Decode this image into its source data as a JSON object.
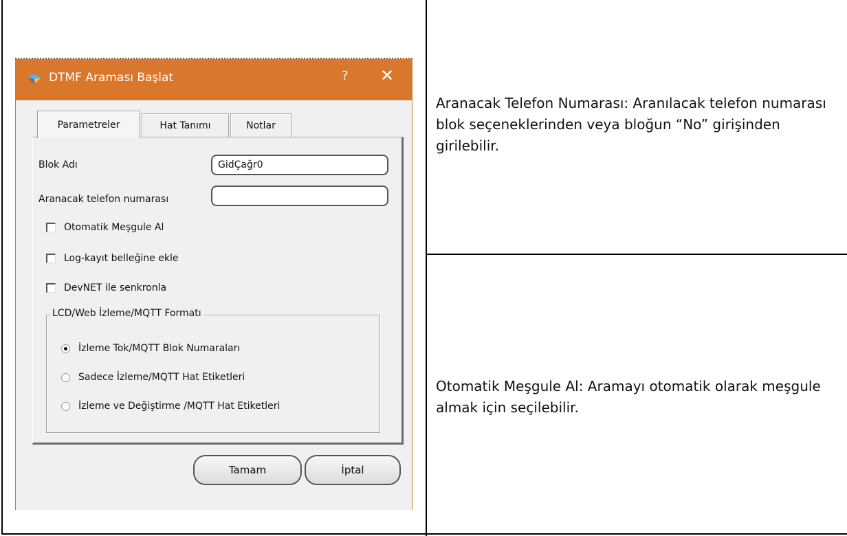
{
  "dialog": {
    "title": "DTMF Araması Başlat",
    "help": "?",
    "close": "✕",
    "tabs": [
      {
        "label": "Parametreler",
        "active": true
      },
      {
        "label": "Hat Tanımı",
        "active": false
      },
      {
        "label": "Notlar",
        "active": false
      }
    ],
    "fields": {
      "block_name_label": "Blok Adı",
      "block_name_value": "GidÇağr0",
      "phone_label": "Aranacak telefon numarası",
      "phone_value": ""
    },
    "checkboxes": [
      {
        "label": "Otomatik Meşgule Al",
        "checked": false
      },
      {
        "label": "Log-kayıt belleğine ekle",
        "checked": false
      },
      {
        "label": "DevNET ile senkronla",
        "checked": false
      }
    ],
    "group": {
      "legend": "LCD/Web İzleme/MQTT Formatı",
      "options": [
        {
          "label": "İzleme Tok/MQTT Blok Numaraları",
          "selected": true
        },
        {
          "label": "Sadece İzleme/MQTT Hat Etiketleri",
          "selected": false
        },
        {
          "label": "İzleme ve Değiştirme /MQTT Hat Etiketleri",
          "selected": false
        }
      ]
    },
    "buttons": {
      "ok": "Tamam",
      "cancel": "İptal"
    },
    "colors": {
      "titlebar": "#d9772c"
    }
  },
  "descriptions": {
    "phone": "Aranacak Telefon Numarası:  Aranılacak telefon numarası blok seçeneklerinden veya bloğun “No” girişinden girilebilir.",
    "auto_busy": "Otomatik Meşgule Al:  Aramayı otomatik olarak meşgule almak için seçilebilir."
  }
}
